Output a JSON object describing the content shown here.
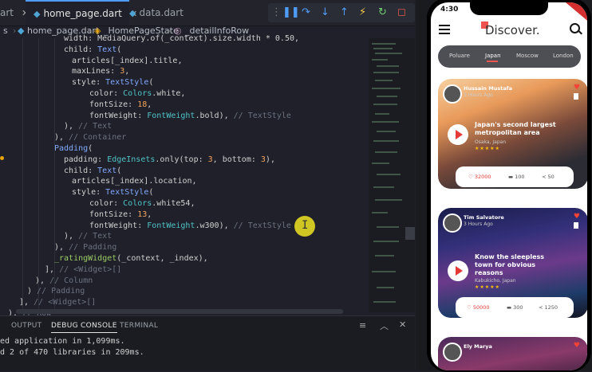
{
  "editor": {
    "tabs": [
      {
        "label": "art"
      },
      {
        "label": "home_page.dart",
        "icon": "dart-file-icon"
      },
      {
        "label": "data.dart",
        "icon": "dart-file-icon"
      }
    ],
    "breadcrumb": {
      "file": "home_page.dart",
      "cls": "_HomePageState",
      "method": "_detailInfoRow"
    },
    "code_lines": [
      {
        "parts": [
          [
            "width: MediaQuery.of(_context).size.width * 0.50,",
            "p"
          ]
        ]
      },
      {
        "parts": [
          [
            "child: ",
            "p"
          ],
          [
            "Text",
            "f"
          ],
          [
            "(",
            "p"
          ]
        ]
      },
      {
        "parts": [
          [
            "articles[_index].title,",
            "p"
          ]
        ]
      },
      {
        "parts": [
          [
            "maxLines: ",
            "p"
          ],
          [
            "3",
            "n"
          ],
          [
            ",",
            "p"
          ]
        ]
      },
      {
        "parts": [
          [
            "style: ",
            "p"
          ],
          [
            "TextStyle",
            "f"
          ],
          [
            "(",
            "p"
          ]
        ]
      },
      {
        "parts": [
          [
            "color: ",
            "p"
          ],
          [
            "Colors",
            "t"
          ],
          [
            ".white,",
            "p"
          ]
        ]
      },
      {
        "parts": [
          [
            "fontSize: ",
            "p"
          ],
          [
            "18",
            "n"
          ],
          [
            ",",
            "p"
          ]
        ]
      },
      {
        "parts": [
          [
            "fontWeight: ",
            "p"
          ],
          [
            "FontWeight",
            "t"
          ],
          [
            ".bold), ",
            "p"
          ],
          [
            "// TextStyle",
            "c"
          ]
        ]
      },
      {
        "parts": [
          [
            "), ",
            "p"
          ],
          [
            "// Text",
            "c"
          ]
        ]
      },
      {
        "parts": [
          [
            "), ",
            "p"
          ],
          [
            "// Container",
            "c"
          ]
        ]
      },
      {
        "parts": [
          [
            "Padding",
            "f"
          ],
          [
            "(",
            "p"
          ]
        ]
      },
      {
        "parts": [
          [
            "padding: ",
            "p"
          ],
          [
            "EdgeInsets",
            "t"
          ],
          [
            ".only(top: ",
            "p"
          ],
          [
            "3",
            "n"
          ],
          [
            ", bottom: ",
            "p"
          ],
          [
            "3",
            "n"
          ],
          [
            "),",
            "p"
          ]
        ]
      },
      {
        "parts": [
          [
            "child: ",
            "p"
          ],
          [
            "Text",
            "f"
          ],
          [
            "(",
            "p"
          ]
        ]
      },
      {
        "parts": [
          [
            "articles[_index].location,",
            "p"
          ]
        ]
      },
      {
        "parts": [
          [
            "style: ",
            "p"
          ],
          [
            "TextStyle",
            "f"
          ],
          [
            "(",
            "p"
          ]
        ]
      },
      {
        "parts": [
          [
            "color: ",
            "p"
          ],
          [
            "Colors",
            "t"
          ],
          [
            ".white54,",
            "p"
          ]
        ]
      },
      {
        "parts": [
          [
            "fontSize: ",
            "p"
          ],
          [
            "13",
            "n"
          ],
          [
            ",",
            "p"
          ]
        ]
      },
      {
        "parts": [
          [
            "fontWeight: ",
            "p"
          ],
          [
            "FontWeight",
            "t"
          ],
          [
            ".w300), ",
            "p"
          ],
          [
            "// TextStyle",
            "c"
          ]
        ]
      },
      {
        "parts": [
          [
            "), ",
            "p"
          ],
          [
            "// Text",
            "c"
          ]
        ]
      },
      {
        "parts": [
          [
            "), ",
            "p"
          ],
          [
            "// Padding",
            "c"
          ]
        ]
      },
      {
        "parts": [
          [
            "_ratingWidget",
            "k"
          ],
          [
            "(_context, _index),",
            "p"
          ]
        ]
      },
      {
        "parts": [
          [
            "], ",
            "p"
          ],
          [
            "// <Widget>[]",
            "c"
          ]
        ]
      },
      {
        "parts": [
          [
            "), ",
            "p"
          ],
          [
            "// Column",
            "c"
          ]
        ]
      },
      {
        "parts": [
          [
            ") ",
            "p"
          ],
          [
            "// Padding",
            "c"
          ]
        ]
      },
      {
        "parts": [
          [
            "], ",
            "p"
          ],
          [
            "// <Widget>[]",
            "c"
          ]
        ]
      },
      {
        "parts": [
          [
            "), ",
            "p"
          ],
          [
            "// Row",
            "c"
          ]
        ]
      }
    ],
    "panel": {
      "tabs": [
        "OUTPUT",
        "DEBUG CONSOLE",
        "TERMINAL"
      ],
      "lines": [
        "ed application in 1,099ms.",
        "d 2 of 470 libraries in 209ms."
      ]
    }
  },
  "phone": {
    "time": "4:30",
    "title": "Discover.",
    "chips": [
      "Poluare",
      "Japan",
      "Moscow",
      "London"
    ],
    "active_chip": "Japan",
    "cards": [
      {
        "author": "Hussain Mustafa",
        "ago": "3 Hours Ago",
        "title": "Japan's second largest metropolitan area",
        "location": "Osaka, Japan",
        "rating": 5,
        "likes": "32000",
        "comments": "100",
        "shares": "50"
      },
      {
        "author": "Tim Salvatore",
        "ago": "3 Hours Ago",
        "title": "Know the sleepless town for obvious reasons",
        "location": "Kabukicho, Japan",
        "rating": 5,
        "likes": "50000",
        "comments": "300",
        "shares": "1250"
      },
      {
        "author": "Ely Marya",
        "ago": "",
        "title": "",
        "location": ""
      }
    ],
    "colors": {
      "accent": "#ef5350",
      "chip_bg": "#4e4e55"
    }
  }
}
